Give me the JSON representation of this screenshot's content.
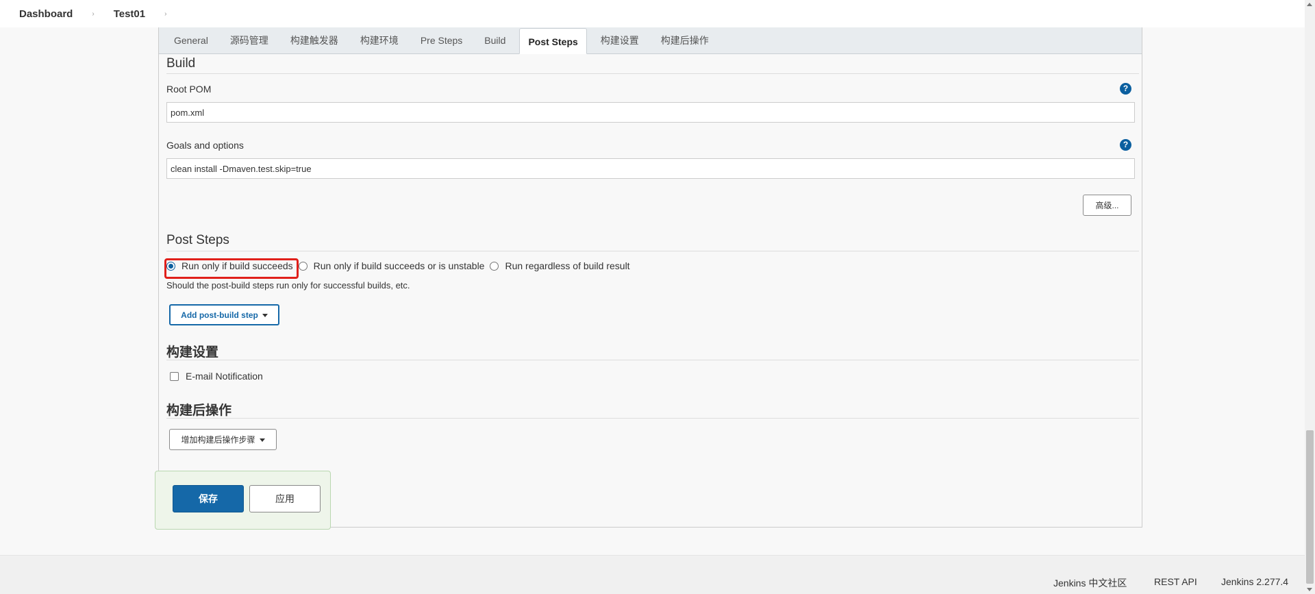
{
  "breadcrumb": {
    "items": [
      "Dashboard",
      "Test01"
    ],
    "separator": "›"
  },
  "tabs": [
    {
      "label": "General",
      "active": false
    },
    {
      "label": "源码管理",
      "active": false
    },
    {
      "label": "构建触发器",
      "active": false
    },
    {
      "label": "构建环境",
      "active": false
    },
    {
      "label": "Pre Steps",
      "active": false
    },
    {
      "label": "Build",
      "active": false
    },
    {
      "label": "Post Steps",
      "active": true
    },
    {
      "label": "构建设置",
      "active": false
    },
    {
      "label": "构建后操作",
      "active": false
    }
  ],
  "build": {
    "title": "Build",
    "root_pom_label": "Root POM",
    "root_pom_value": "pom.xml",
    "goals_label": "Goals and options",
    "goals_value": "clean install -Dmaven.test.skip=true",
    "advanced_button": "高级...",
    "help_glyph": "?"
  },
  "post_steps": {
    "title": "Post Steps",
    "options": [
      {
        "label": "Run only if build succeeds",
        "checked": true
      },
      {
        "label": "Run only if build succeeds or is unstable",
        "checked": false
      },
      {
        "label": "Run regardless of build result",
        "checked": false
      }
    ],
    "description": "Should the post-build steps run only for successful builds, etc.",
    "add_button": "Add post-build step"
  },
  "build_settings": {
    "title": "构建设置",
    "email_label": "E-mail Notification",
    "email_checked": false
  },
  "post_build_actions": {
    "title": "构建后操作",
    "add_button": "增加构建后操作步骤"
  },
  "actions": {
    "save": "保存",
    "apply": "应用"
  },
  "footer": {
    "community": "Jenkins 中文社区",
    "rest_api": "REST API",
    "version": "Jenkins 2.277.4"
  },
  "colors": {
    "accent": "#1568a8",
    "highlight": "#e0201b",
    "save_bar_bg": "#eef5ea"
  }
}
